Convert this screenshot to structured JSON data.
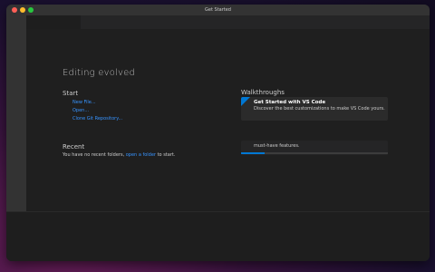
{
  "window": {
    "title": "Get Started"
  },
  "welcome": {
    "subtitle": "Editing evolved",
    "start": {
      "heading": "Start",
      "items": [
        {
          "label": "New File..."
        },
        {
          "label": "Open..."
        },
        {
          "label": "Clone Git Repository..."
        }
      ]
    },
    "recent": {
      "heading": "Recent",
      "text_before": "You have no recent folders, ",
      "link": "open a folder",
      "text_after": " to start."
    },
    "walkthroughs": {
      "heading": "Walkthroughs",
      "featured": {
        "title": "Get Started with VS Code",
        "description": "Discover the best customizations to make VS Code yours."
      },
      "second": {
        "text": "must-have features.",
        "progress": 0.16
      }
    }
  },
  "colors": {
    "accent": "#0078d4",
    "link": "#3794ff",
    "background": "#1f1f1f"
  }
}
